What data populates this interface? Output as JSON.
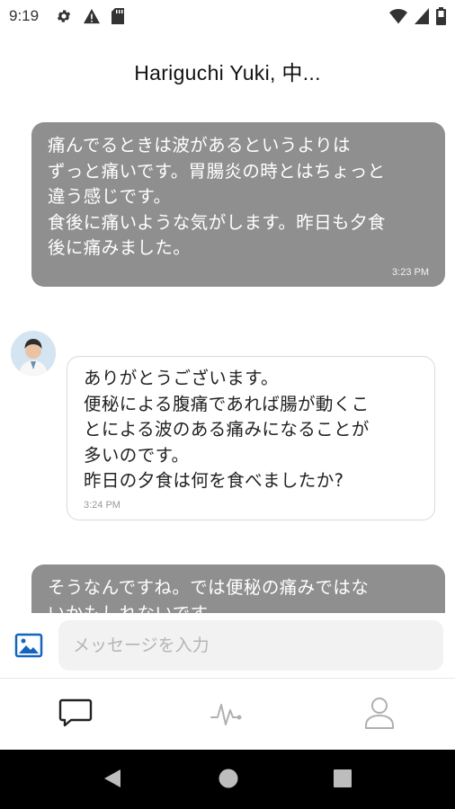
{
  "status_bar": {
    "time": "9:19"
  },
  "header": {
    "title": "Hariguchi Yuki, 中..."
  },
  "messages": [
    {
      "direction": "outgoing",
      "text": "痛んでるときは波があるというよりは\nずっと痛いです。胃腸炎の時とはちょっと\n違う感じです。\n食後に痛いような気がします。昨日も夕食\n後に痛みました。",
      "time": "3:23 PM"
    },
    {
      "direction": "incoming",
      "text": "ありがとうございます。\n便秘による腹痛であれば腸が動くこ\nとによる波のある痛みになることが\n多いのです。\n昨日の夕食は何を食べましたか?",
      "time": "3:24 PM"
    },
    {
      "direction": "outgoing",
      "text": "そうなんですね。では便秘の痛みではな\nいかもしれないです。",
      "time": ""
    }
  ],
  "input": {
    "placeholder": "メッセージを入力"
  },
  "nav": {
    "items": [
      "chat",
      "vitals",
      "profile"
    ],
    "active": "chat"
  },
  "colors": {
    "outgoing_bubble": "#8f8f8f",
    "accent_blue": "#1565c0"
  }
}
